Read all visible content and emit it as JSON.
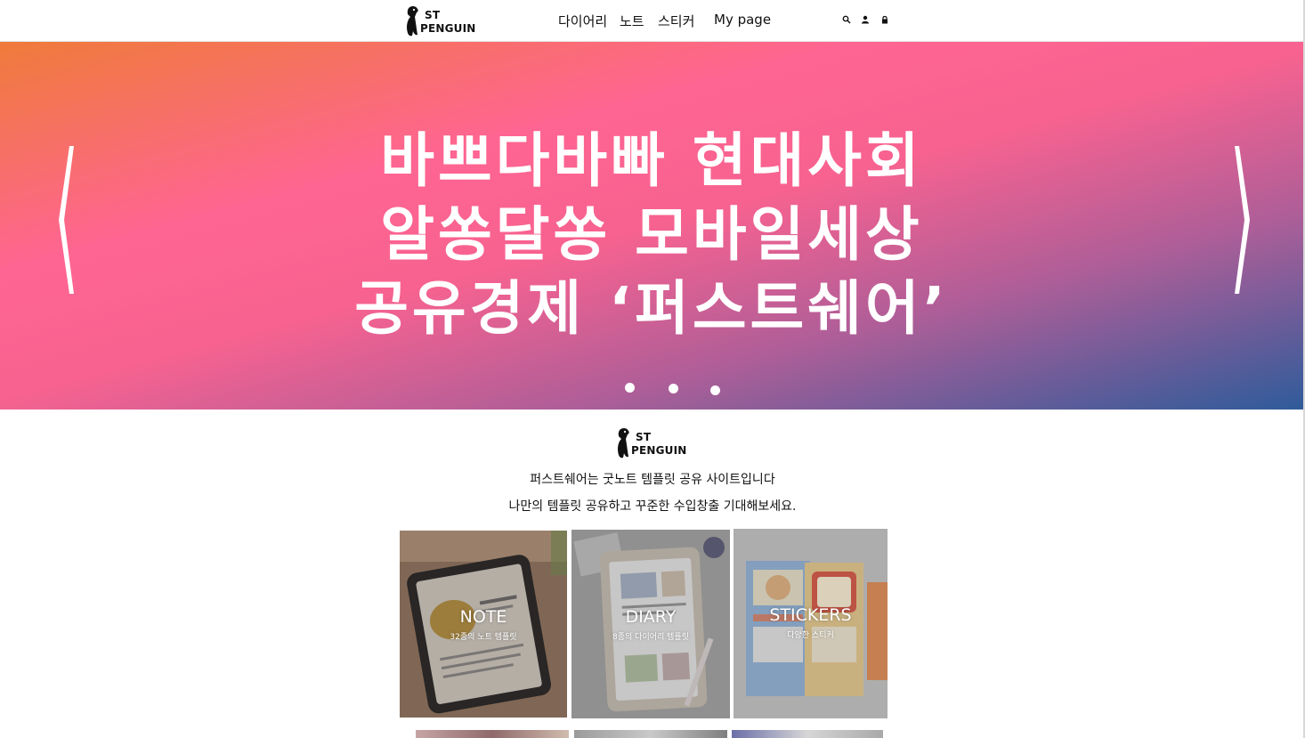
{
  "header": {
    "logo": {
      "line1": "ST",
      "line2": "PENGUIN"
    },
    "nav": [
      {
        "label": "다이어리"
      },
      {
        "label": "노트"
      },
      {
        "label": "스티커"
      },
      {
        "label": "My page"
      }
    ],
    "icons": [
      "search-icon",
      "user-icon",
      "lock-icon"
    ]
  },
  "hero": {
    "lines": [
      "바쁘다바빠 현대사회",
      "알쏭달쏭 모바일세상",
      "공유경제 ‘퍼스트쉐어’"
    ],
    "prev_icon": "chevron-left-icon",
    "next_icon": "chevron-right-icon",
    "slide_count": 3
  },
  "intro": {
    "logo": {
      "line1": "ST",
      "line2": "PENGUIN"
    },
    "line1": "퍼스트쉐어는 굿노트 템플릿 공유 사이트입니다",
    "line2": "나만의 템플릿 공유하고 꾸준한 수입창출 기대해보세요."
  },
  "categories": [
    {
      "title": "NOTE",
      "subtitle": "32종의 노트 템플릿"
    },
    {
      "title": "DIARY",
      "subtitle": "8종의 다이어리 템플릿"
    },
    {
      "title": "STICKERS",
      "subtitle": "다양한 스티커"
    }
  ]
}
